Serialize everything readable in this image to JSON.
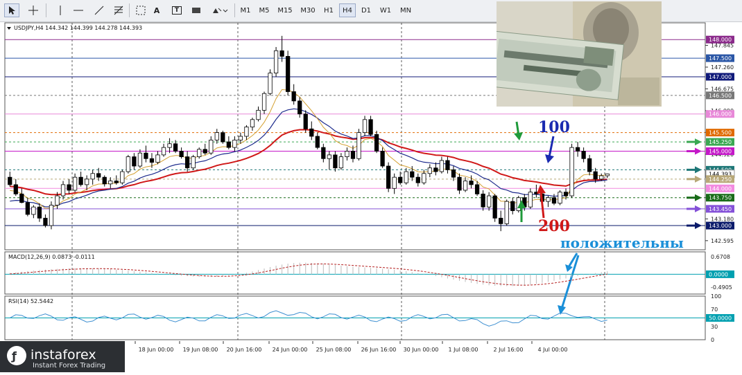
{
  "toolbar": {
    "timeframes": [
      "M1",
      "M5",
      "M15",
      "M30",
      "H1",
      "H4",
      "D1",
      "W1",
      "MN"
    ],
    "selected": "H4",
    "tools": [
      "cursor-icon",
      "crosshair-icon",
      "vertical-line-icon",
      "horizontal-line-icon",
      "trendline-icon",
      "fibonacci-icon",
      "text-icon",
      "label-icon",
      "rectangle-icon",
      "shapes-icon"
    ],
    "text_tool": "A",
    "label_tool": "T"
  },
  "main": {
    "header": "USDJPY,H4  144.342 144.399 144.278 144.393"
  },
  "macd": {
    "header": "MACD(12,26,9) 0.0873 -0.0111"
  },
  "rsi": {
    "header": "RSI(14) 52.5442"
  },
  "annotations": {
    "ma100": "100",
    "ma200": "200",
    "positive": "положительны"
  },
  "logo": {
    "name": "instaforex",
    "tagline": "Instant Forex Trading"
  },
  "colors": {
    "candle_up": "#ffffff",
    "candle_down": "#000000",
    "ma200": "#d01818",
    "ma100": "#1c2a8c",
    "ma50": "#d4a030",
    "macd_signal": "#b41e1e",
    "rsi_line": "#3d8fd1",
    "level_cyan": "#00a0b0"
  },
  "chart_data": [
    {
      "type": "candlestick",
      "symbol": "USDJPY",
      "timeframe": "H4",
      "x_labels": [
        "18 Jun 00:00",
        "19 Jun 08:00",
        "20 Jun 16:00",
        "24 Jun 00:00",
        "25 Jun 08:00",
        "26 Jun 16:00",
        "30 Jun 00:00",
        "1 Jul 08:00",
        "2 Jul 16:00",
        "4 Jul 00:00"
      ],
      "y_ticks": [
        147.845,
        147.26,
        146.675,
        146.09,
        145.505,
        144.92,
        144.335,
        143.75,
        143.18,
        142.595
      ],
      "levels": [
        {
          "value": 148.0,
          "label": "148.000",
          "color": "#8b2a8b"
        },
        {
          "value": 147.5,
          "label": "147.500",
          "color": "#2a56a6"
        },
        {
          "value": 147.0,
          "label": "147.000",
          "color": "#101a7a"
        },
        {
          "value": 146.5,
          "label": "146.500",
          "color": "#777777"
        },
        {
          "value": 146.0,
          "label": "146.000",
          "color": "#e888d8"
        },
        {
          "value": 145.5,
          "label": "145.500",
          "color": "#e06a00"
        },
        {
          "value": 145.25,
          "label": "145.250",
          "color": "#3aa852"
        },
        {
          "value": 145.0,
          "label": "145.000",
          "color": "#c418c8"
        },
        {
          "value": 144.5,
          "label": "144.500",
          "color": "#1e7777"
        },
        {
          "value": 144.39,
          "label": "144.393",
          "color": "#ffffff"
        },
        {
          "value": 144.25,
          "label": "144.250",
          "color": "#b8a878"
        },
        {
          "value": 144.0,
          "label": "144.000",
          "color": "#f28ae0"
        },
        {
          "value": 143.75,
          "label": "143.750",
          "color": "#186b18"
        },
        {
          "value": 143.45,
          "label": "143.450",
          "color": "#8450d8"
        },
        {
          "value": 143.0,
          "label": "143.000",
          "color": "#0a1a6a"
        }
      ],
      "ohlc": [
        [
          144.3,
          144.45,
          144.05,
          144.1
        ],
        [
          144.1,
          144.25,
          143.8,
          143.85
        ],
        [
          143.85,
          144.0,
          143.6,
          143.62
        ],
        [
          143.62,
          143.75,
          143.25,
          143.3
        ],
        [
          143.3,
          143.55,
          143.2,
          143.5
        ],
        [
          143.5,
          143.6,
          143.1,
          143.2
        ],
        [
          143.2,
          143.3,
          142.95,
          143.0
        ],
        [
          143.0,
          143.65,
          142.9,
          143.55
        ],
        [
          143.55,
          143.9,
          143.45,
          143.8
        ],
        [
          143.8,
          144.2,
          143.7,
          144.1
        ],
        [
          144.1,
          144.25,
          143.85,
          143.95
        ],
        [
          143.95,
          144.4,
          143.9,
          144.3
        ],
        [
          144.3,
          144.45,
          144.05,
          144.1
        ],
        [
          144.1,
          144.35,
          143.95,
          144.25
        ],
        [
          144.25,
          144.5,
          144.1,
          144.4
        ],
        [
          144.4,
          144.55,
          144.2,
          144.3
        ],
        [
          144.3,
          144.35,
          144.05,
          144.12
        ],
        [
          144.12,
          144.3,
          144.0,
          144.2
        ],
        [
          144.2,
          144.35,
          144.1,
          144.15
        ],
        [
          144.15,
          144.5,
          144.1,
          144.45
        ],
        [
          144.45,
          144.9,
          144.4,
          144.85
        ],
        [
          144.85,
          144.95,
          144.5,
          144.6
        ],
        [
          144.6,
          145.05,
          144.55,
          144.95
        ],
        [
          144.95,
          145.15,
          144.7,
          144.8
        ],
        [
          144.8,
          144.95,
          144.55,
          144.7
        ],
        [
          144.7,
          145.0,
          144.65,
          144.9
        ],
        [
          144.9,
          145.2,
          144.85,
          145.1
        ],
        [
          145.1,
          145.35,
          144.95,
          145.2
        ],
        [
          145.2,
          145.3,
          144.95,
          145.0
        ],
        [
          145.0,
          145.1,
          144.8,
          144.85
        ],
        [
          144.85,
          145.0,
          144.45,
          144.55
        ],
        [
          144.55,
          144.9,
          144.5,
          144.85
        ],
        [
          144.85,
          145.1,
          144.8,
          145.05
        ],
        [
          145.05,
          145.2,
          144.9,
          144.95
        ],
        [
          144.95,
          145.4,
          144.9,
          145.3
        ],
        [
          145.3,
          145.6,
          145.2,
          145.5
        ],
        [
          145.5,
          145.55,
          145.2,
          145.25
        ],
        [
          145.25,
          145.4,
          145.05,
          145.1
        ],
        [
          145.1,
          145.4,
          145.0,
          145.3
        ],
        [
          145.3,
          145.5,
          145.2,
          145.4
        ],
        [
          145.4,
          145.7,
          145.3,
          145.65
        ],
        [
          145.65,
          145.9,
          145.55,
          145.85
        ],
        [
          145.85,
          146.2,
          145.8,
          146.1
        ],
        [
          146.1,
          146.6,
          146.0,
          146.55
        ],
        [
          146.55,
          147.2,
          146.5,
          147.1
        ],
        [
          147.1,
          147.8,
          147.0,
          147.7
        ],
        [
          147.7,
          148.1,
          147.4,
          147.55
        ],
        [
          147.55,
          147.7,
          146.5,
          146.6
        ],
        [
          146.6,
          146.8,
          146.25,
          146.35
        ],
        [
          146.35,
          146.45,
          145.9,
          146.0
        ],
        [
          146.0,
          146.1,
          145.5,
          145.6
        ],
        [
          145.6,
          145.8,
          145.3,
          145.4
        ],
        [
          145.4,
          145.5,
          145.05,
          145.1
        ],
        [
          145.1,
          145.2,
          144.7,
          144.8
        ],
        [
          144.8,
          145.0,
          144.5,
          144.9
        ],
        [
          144.9,
          145.0,
          144.45,
          144.55
        ],
        [
          144.55,
          144.95,
          144.5,
          144.85
        ],
        [
          144.85,
          145.1,
          144.75,
          145.0
        ],
        [
          145.0,
          145.15,
          144.7,
          144.8
        ],
        [
          144.8,
          145.6,
          144.75,
          145.5
        ],
        [
          145.5,
          145.95,
          145.4,
          145.85
        ],
        [
          145.85,
          145.95,
          145.4,
          145.45
        ],
        [
          145.45,
          145.55,
          144.95,
          145.0
        ],
        [
          145.0,
          145.1,
          144.55,
          144.6
        ],
        [
          144.6,
          144.7,
          143.9,
          144.0
        ],
        [
          144.0,
          144.4,
          143.85,
          144.3
        ],
        [
          144.3,
          144.45,
          144.1,
          144.15
        ],
        [
          144.15,
          144.55,
          144.1,
          144.45
        ],
        [
          144.45,
          144.6,
          144.2,
          144.3
        ],
        [
          144.3,
          144.4,
          144.05,
          144.15
        ],
        [
          144.15,
          144.5,
          144.1,
          144.4
        ],
        [
          144.4,
          144.65,
          144.3,
          144.55
        ],
        [
          144.55,
          144.7,
          144.35,
          144.45
        ],
        [
          144.45,
          144.85,
          144.4,
          144.75
        ],
        [
          144.75,
          144.85,
          144.4,
          144.5
        ],
        [
          144.5,
          144.6,
          144.2,
          144.3
        ],
        [
          144.3,
          144.4,
          143.85,
          143.95
        ],
        [
          143.95,
          144.3,
          143.9,
          144.2
        ],
        [
          144.2,
          144.35,
          144.0,
          144.1
        ],
        [
          144.1,
          144.2,
          143.8,
          143.85
        ],
        [
          143.85,
          143.95,
          143.4,
          143.5
        ],
        [
          143.5,
          143.9,
          143.4,
          143.8
        ],
        [
          143.8,
          143.85,
          143.1,
          143.2
        ],
        [
          143.2,
          143.4,
          142.85,
          143.05
        ],
        [
          143.05,
          143.7,
          143.0,
          143.65
        ],
        [
          143.65,
          143.75,
          143.3,
          143.4
        ],
        [
          143.4,
          143.8,
          143.35,
          143.75
        ],
        [
          143.75,
          143.85,
          143.4,
          143.5
        ],
        [
          143.5,
          144.0,
          143.45,
          143.9
        ],
        [
          143.9,
          144.1,
          143.75,
          143.85
        ],
        [
          143.85,
          143.95,
          143.55,
          143.65
        ],
        [
          143.65,
          143.8,
          143.5,
          143.75
        ],
        [
          143.75,
          143.85,
          143.55,
          143.6
        ],
        [
          143.6,
          143.95,
          143.55,
          143.9
        ],
        [
          143.9,
          144.0,
          143.7,
          143.8
        ],
        [
          143.8,
          145.2,
          143.75,
          145.1
        ],
        [
          145.1,
          145.25,
          144.85,
          145.0
        ],
        [
          145.0,
          145.1,
          144.7,
          144.8
        ],
        [
          144.8,
          144.9,
          144.35,
          144.45
        ],
        [
          144.45,
          144.55,
          144.15,
          144.25
        ],
        [
          144.25,
          144.4,
          144.2,
          144.34
        ],
        [
          144.34,
          144.4,
          144.28,
          144.39
        ]
      ],
      "ma": [
        {
          "period": 200,
          "color": "#d01818",
          "values_start": 144.2,
          "peak": 144.6,
          "end": 144.35
        },
        {
          "period": 100,
          "color": "#1c2a8c"
        },
        {
          "period": 50,
          "color": "#d4a030"
        }
      ]
    },
    {
      "type": "histogram",
      "name": "MACD(12,26,9)",
      "y_ticks": [
        0.6708,
        0.0,
        -0.4905
      ],
      "current_value": 0.0873,
      "signal_value": -0.0111,
      "level_label": "0.0000"
    },
    {
      "type": "line",
      "name": "RSI(14)",
      "y_ticks": [
        100,
        70,
        30,
        0
      ],
      "level_label": "50.0000",
      "current_value": 52.5442
    }
  ]
}
